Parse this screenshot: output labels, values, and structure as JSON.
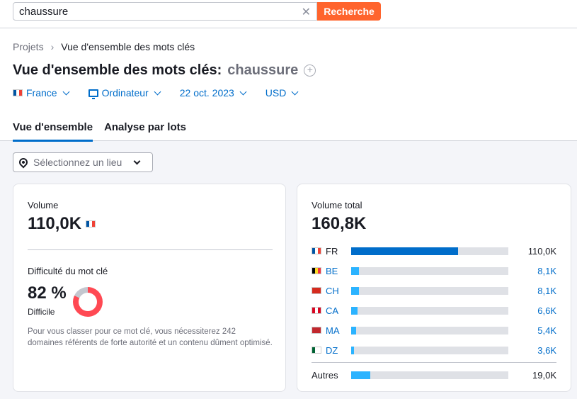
{
  "search": {
    "value": "chaussure",
    "button_label": "Recherche"
  },
  "breadcrumb": {
    "root": "Projets",
    "current": "Vue d'ensemble des mots clés"
  },
  "header": {
    "title": "Vue d'ensemble des mots clés:",
    "keyword": "chaussure"
  },
  "filters": {
    "country": "France",
    "device": "Ordinateur",
    "date": "22 oct. 2023",
    "currency": "USD"
  },
  "tabs": [
    {
      "label": "Vue d'ensemble"
    },
    {
      "label": "Analyse par lots"
    }
  ],
  "location_select": {
    "placeholder": "Sélectionnez un lieu"
  },
  "volume_card": {
    "volume_label": "Volume",
    "volume_value": "110,0K",
    "difficulty_label": "Difficulté du mot clé",
    "difficulty_value": "82 %",
    "difficulty_text": "Difficile",
    "difficulty_percent": 82,
    "description": "Pour vous classer pour ce mot clé, vous nécessiterez 242 domaines référents de forte autorité et un contenu dûment optimisé."
  },
  "total_card": {
    "label": "Volume total",
    "value": "160,8K",
    "countries": [
      {
        "code": "FR",
        "value": "110,0K",
        "share": 0.68,
        "flag": [
          "#0055a4",
          "#ffffff",
          "#ef4135"
        ],
        "fill": "#006dca"
      },
      {
        "code": "BE",
        "value": "8,1K",
        "share": 0.05,
        "flag": [
          "#000000",
          "#fdda24",
          "#ef3340"
        ],
        "fill": "#2bb3ff"
      },
      {
        "code": "CH",
        "value": "8,1K",
        "share": 0.05,
        "flag": [
          "#d52b1e",
          "#d52b1e",
          "#d52b1e"
        ],
        "fill": "#2bb3ff"
      },
      {
        "code": "CA",
        "value": "6,6K",
        "share": 0.04,
        "flag": [
          "#d80621",
          "#ffffff",
          "#d80621"
        ],
        "fill": "#2bb3ff"
      },
      {
        "code": "MA",
        "value": "5,4K",
        "share": 0.03,
        "flag": [
          "#c1272d",
          "#c1272d",
          "#c1272d"
        ],
        "fill": "#2bb3ff"
      },
      {
        "code": "DZ",
        "value": "3,6K",
        "share": 0.02,
        "flag": [
          "#006233",
          "#ffffff",
          "#ffffff"
        ],
        "fill": "#2bb3ff"
      }
    ],
    "others": {
      "label": "Autres",
      "value": "19,0K",
      "share": 0.12,
      "fill": "#2bb3ff"
    }
  },
  "colors": {
    "accent": "#006dca",
    "brand": "#ff642d",
    "difficulty": "#ff4953"
  }
}
